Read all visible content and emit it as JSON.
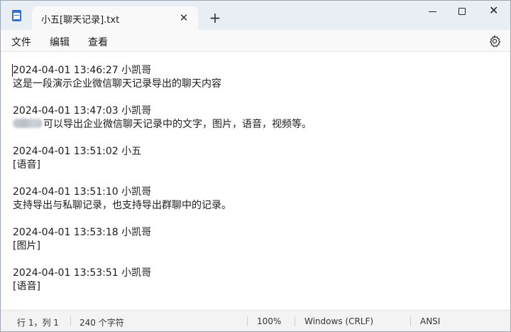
{
  "tab": {
    "title": "小五[聊天记录].txt",
    "close_glyph": "✕",
    "new_tab_glyph": "+"
  },
  "window_controls": {
    "close_glyph": "✕"
  },
  "menu": {
    "file": "文件",
    "edit": "编辑",
    "view": "查看"
  },
  "icons": {
    "app": "notepad-icon",
    "settings": "gear-icon"
  },
  "content": {
    "lines": [
      "2024-04-01 13:46:27 小凯哥",
      "这是一段演示企业微信聊天记录导出的聊天内容",
      "2024-04-01 13:47:03 小凯哥",
      "可以导出企业微信聊天记录中的文字，图片，语音，视频等。",
      "2024-04-01 13:51:02 小五",
      "[语音]",
      "2024-04-01 13:51:10 小凯哥",
      "支持导出与私聊记录，也支持导出群聊中的记录。",
      "2024-04-01 13:53:18 小凯哥",
      "[图片]",
      "2024-04-01 13:53:51 小凯哥",
      "[语音]"
    ]
  },
  "status": {
    "position": "行 1，列 1",
    "char_count": "240 个字符",
    "zoom": "100%",
    "line_ending": "Windows (CRLF)",
    "encoding": "ANSI"
  },
  "colors": {
    "title_bar": "#e9eef5",
    "app_icon": "#2f6fd0",
    "status_bar": "#f3f3f3"
  }
}
